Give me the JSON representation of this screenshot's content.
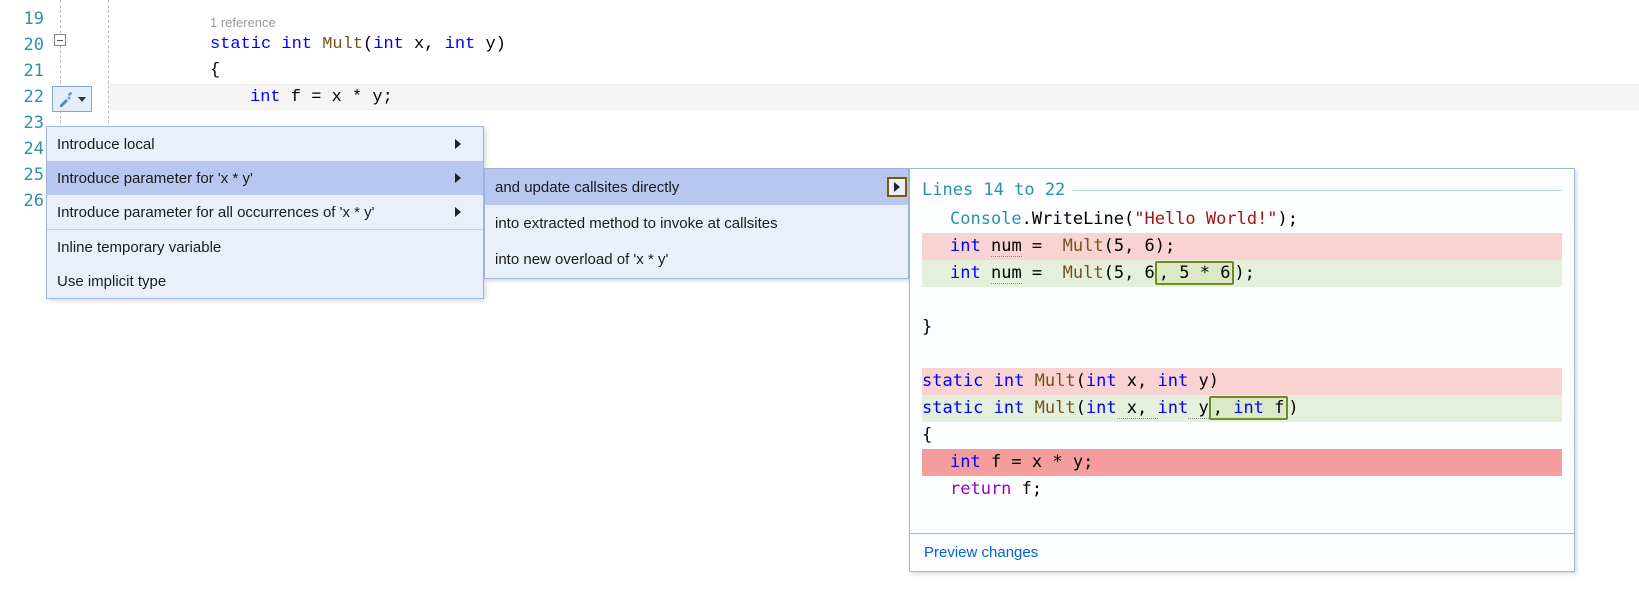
{
  "editor": {
    "line_numbers": [
      "19",
      "20",
      "21",
      "22",
      "23",
      "24",
      "25",
      "26"
    ],
    "codelens": "1 reference",
    "line19_tokens": {
      "static": "static",
      "int": "int",
      "mult": "Mult",
      "sig": "(",
      "kwint1": "int",
      "x": " x, ",
      "kwint2": "int",
      "y": " y)"
    },
    "line20": "{",
    "line21": {
      "int": "int",
      "rest": " f = x * y;"
    }
  },
  "menu1": {
    "items": [
      "Introduce local",
      "Introduce parameter for 'x * y'",
      "Introduce parameter for all occurrences of 'x * y'",
      "Inline temporary variable",
      "Use implicit type"
    ]
  },
  "menu2": {
    "items": [
      "and update callsites directly",
      "into extracted method to invoke at callsites",
      "into new overload of 'x * y'"
    ]
  },
  "preview": {
    "header": "Lines 14 to 22",
    "l1": {
      "a": "Console",
      "b": ".WriteLine(",
      "c": "\"Hello World!\"",
      "d": ");"
    },
    "l2": {
      "int": "int",
      "num": "num",
      "eq": " =  ",
      "mult": "Mult",
      "args": "(5, 6);"
    },
    "l3": {
      "int": "int",
      "num": "num",
      "eq": " =  ",
      "mult": "Mult",
      "args_pre": "(5, 6",
      "hl": ", 5 * 6",
      "args_post": ");"
    },
    "l4": "}",
    "l5": {
      "static": "static",
      "int": "int",
      "mult": "Mult",
      "sig": "(",
      "int1": "int",
      "x": " x, ",
      "int2": "int",
      "y": " y)"
    },
    "l6": {
      "static": "static",
      "int": "int",
      "mult": "Mult",
      "sig": "(",
      "int1": "int",
      "x": " x, ",
      "int2": "int",
      "y_pre": " y",
      "hl_pre": ", ",
      "hl_int": "int",
      "hl_post": " f",
      "close": ")"
    },
    "l7": "{",
    "l8": {
      "int": "int",
      "rest": " f = x * y;"
    },
    "l9": {
      "ret": "return",
      "rest": " f;"
    },
    "footer": "Preview changes"
  }
}
